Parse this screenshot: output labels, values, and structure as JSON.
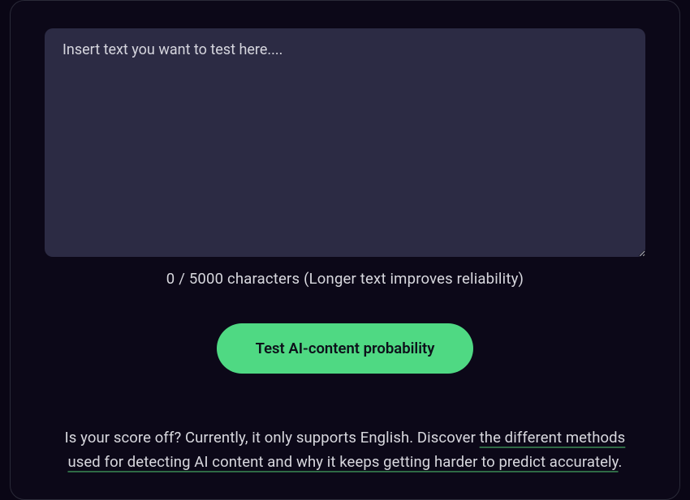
{
  "input": {
    "placeholder": "Insert text you want to test here....",
    "value": ""
  },
  "counter": {
    "current": 0,
    "max": 5000,
    "hint": "(Longer text improves reliability)"
  },
  "button": {
    "label": "Test AI-content probability"
  },
  "footer": {
    "prefix": "Is your score off? Currently, it only supports English. Discover ",
    "link": "the different methods used for detecting AI content and why it keeps getting harder to predict accurately",
    "suffix": "."
  },
  "colors": {
    "accent": "#4fd983",
    "bg": "#0a0615",
    "panel": "#0c0818",
    "textarea": "#2c2b44"
  }
}
